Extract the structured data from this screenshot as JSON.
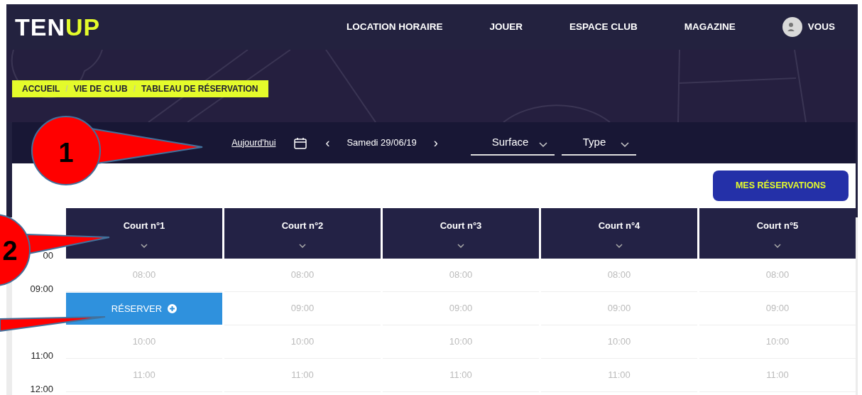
{
  "logo": [
    {
      "text": "TEN",
      "accent": false
    },
    {
      "text": "UP",
      "accent": true
    }
  ],
  "nav": [
    {
      "label": "LOCATION HORAIRE"
    },
    {
      "label": "JOUER"
    },
    {
      "label": "ESPACE CLUB"
    },
    {
      "label": "MAGAZINE"
    }
  ],
  "account": {
    "label": "VOUS"
  },
  "breadcrumb": {
    "separator": "/",
    "items": [
      "ACCUEIL",
      "VIE DE CLUB",
      "TABLEAU DE RÉSERVATION"
    ]
  },
  "filters": {
    "today": "Aujourd'hui",
    "prev": "‹",
    "date": "Samedi 29/06/19",
    "next": "›",
    "selects": [
      {
        "label": "Surface"
      },
      {
        "label": "Type"
      }
    ]
  },
  "my_reservations": "MES RÉSERVATIONS",
  "time_axis": [
    "00",
    "09:00",
    "11:00",
    "12:00"
  ],
  "courts": [
    {
      "name": "Court n°1",
      "slots": [
        {
          "kind": "time",
          "text": "08:00"
        },
        {
          "kind": "reserve",
          "text": "RÉSERVER"
        },
        {
          "kind": "time",
          "text": "10:00"
        },
        {
          "kind": "time",
          "text": "11:00"
        }
      ]
    },
    {
      "name": "Court n°2",
      "slots": [
        {
          "kind": "time",
          "text": "08:00"
        },
        {
          "kind": "time",
          "text": "09:00"
        },
        {
          "kind": "time",
          "text": "10:00"
        },
        {
          "kind": "time",
          "text": "11:00"
        }
      ]
    },
    {
      "name": "Court n°3",
      "slots": [
        {
          "kind": "time",
          "text": "08:00"
        },
        {
          "kind": "time",
          "text": "09:00"
        },
        {
          "kind": "time",
          "text": "10:00"
        },
        {
          "kind": "time",
          "text": "11:00"
        }
      ]
    },
    {
      "name": "Court n°4",
      "slots": [
        {
          "kind": "time",
          "text": "08:00"
        },
        {
          "kind": "time",
          "text": "09:00"
        },
        {
          "kind": "time",
          "text": "10:00"
        },
        {
          "kind": "time",
          "text": "11:00"
        }
      ]
    },
    {
      "name": "Court n°5",
      "slots": [
        {
          "kind": "time",
          "text": "08:00"
        },
        {
          "kind": "time",
          "text": "09:00"
        },
        {
          "kind": "time",
          "text": "10:00"
        },
        {
          "kind": "time",
          "text": "11:00"
        }
      ]
    }
  ],
  "callouts": [
    {
      "kind": "badge",
      "label": "1"
    },
    {
      "kind": "badge",
      "label": "2"
    },
    {
      "kind": "pointer"
    }
  ]
}
